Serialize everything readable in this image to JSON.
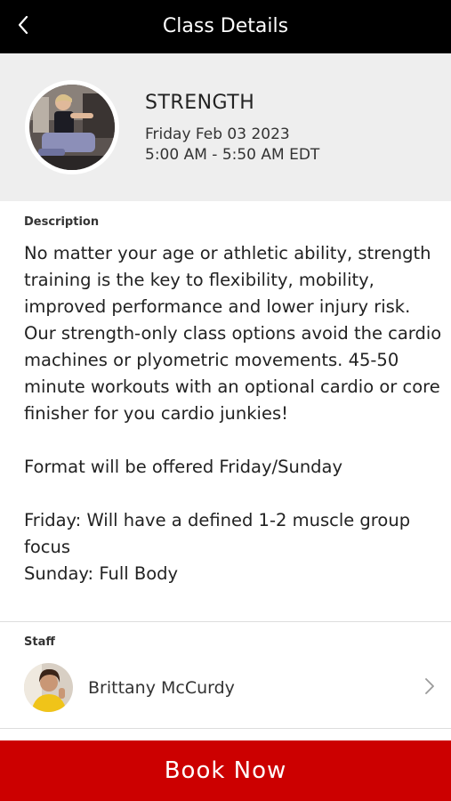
{
  "header": {
    "title": "Class Details",
    "back_icon": "chevron-left-icon"
  },
  "class": {
    "name": "STRENGTH",
    "date": "Friday Feb 03 2023",
    "time": "5:00 AM - 5:50 AM EDT"
  },
  "description": {
    "label": "Description",
    "paragraphs": [
      "No matter your age or athletic ability, strength training is the key to flexibility, mobility, improved performance and lower injury risk. Our strength-only class options avoid the cardio machines or plyometric movements. 45-50 minute workouts with an optional cardio or core finisher for you cardio junkies!",
      "Format will be offered Friday/Sunday",
      "Friday: Will have a defined 1-2 muscle group focus",
      "Sunday: Full Body"
    ]
  },
  "staff": {
    "label": "Staff",
    "name": "Brittany McCurdy",
    "chevron_icon": "chevron-right-icon"
  },
  "book_button": {
    "label": "Book Now"
  },
  "colors": {
    "topbar": "#000000",
    "header_bg": "#eeeeee",
    "accent": "#cc0000"
  }
}
